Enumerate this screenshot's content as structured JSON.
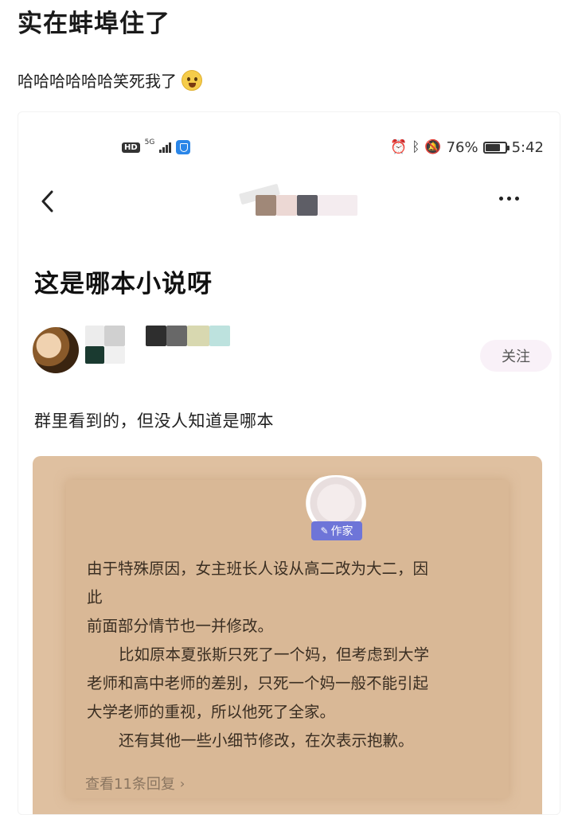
{
  "outer": {
    "title": "实在蚌埠住了",
    "subtitle": "哈哈哈哈哈哈笑死我了"
  },
  "status_bar": {
    "hd": "HD",
    "network": "5G",
    "battery": "76%",
    "battery_level": 0.76,
    "time": "5:42",
    "icons": [
      "alarm-icon",
      "bluetooth-icon",
      "mute-bell-icon"
    ]
  },
  "post": {
    "title": "这是哪本小说呀",
    "follow_label": "关注",
    "body": "群里看到的，但没人知道是哪本"
  },
  "image": {
    "author_tag": "作家",
    "lines": [
      "由于特殊原因，女主班长人设从高二改为大二，因",
      "此",
      "前面部分情节也一并修改。",
      "比如原本夏张斯只死了一个妈，但考虑到大学",
      "老师和高中老师的差别，只死一个妈一般不能引起",
      "大学老师的重视，所以他死了全家。",
      "还有其他一些小细节修改，在次表示抱歉。"
    ],
    "view_replies": "查看11条回复"
  },
  "colors": {
    "background": "#ffffff",
    "image_bg": "#dfc0a0",
    "author_tag_bg": "#6e75d8",
    "follow_bg": "#f9f1f8"
  }
}
